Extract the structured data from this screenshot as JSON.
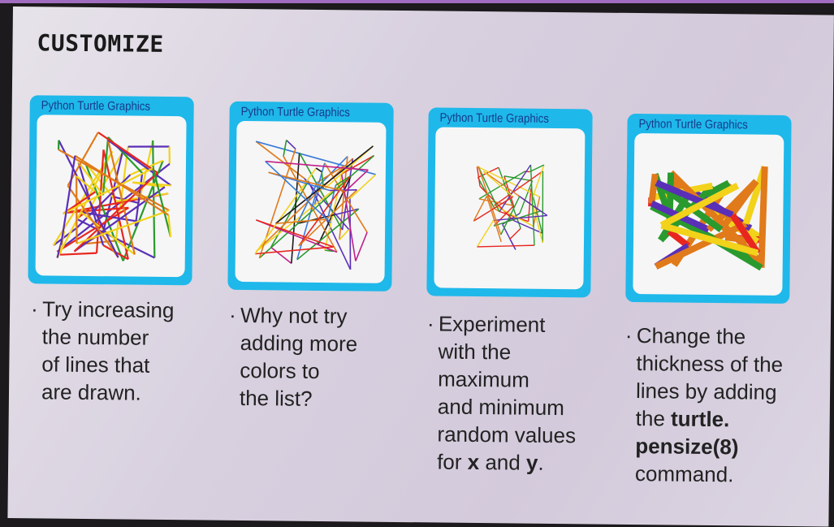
{
  "heading": "CUSTOMIZE",
  "palette": [
    "#e8261f",
    "#f2d21a",
    "#2a9a2e",
    "#5a2fb8",
    "#e07a1a",
    "#c0208a",
    "#1a1a1a",
    "#3a7ad8"
  ],
  "cards": [
    {
      "window_title": "Python Turtle Graphics",
      "tip": [
        "Try increasing",
        "the number",
        "of lines that",
        "are drawn."
      ]
    },
    {
      "window_title": "Python Turtle Graphics",
      "tip": [
        "Why not try",
        "adding more",
        "colors to",
        "the list?"
      ]
    },
    {
      "window_title": "Python Turtle Graphics",
      "tip": [
        "Experiment",
        "with the",
        "maximum",
        "and minimum",
        "random values"
      ],
      "tip_last": {
        "pre": "for ",
        "b1": "x",
        "mid": " and ",
        "b2": "y",
        "post": "."
      }
    },
    {
      "window_title": "Python Turtle Graphics",
      "tip": [
        "Change the",
        "thickness of the",
        "lines by adding",
        "the "
      ],
      "tip_bold1": "turtle.",
      "tip_bold2": "pensize(8)",
      "tip_end": "command."
    }
  ],
  "bullet": "·"
}
